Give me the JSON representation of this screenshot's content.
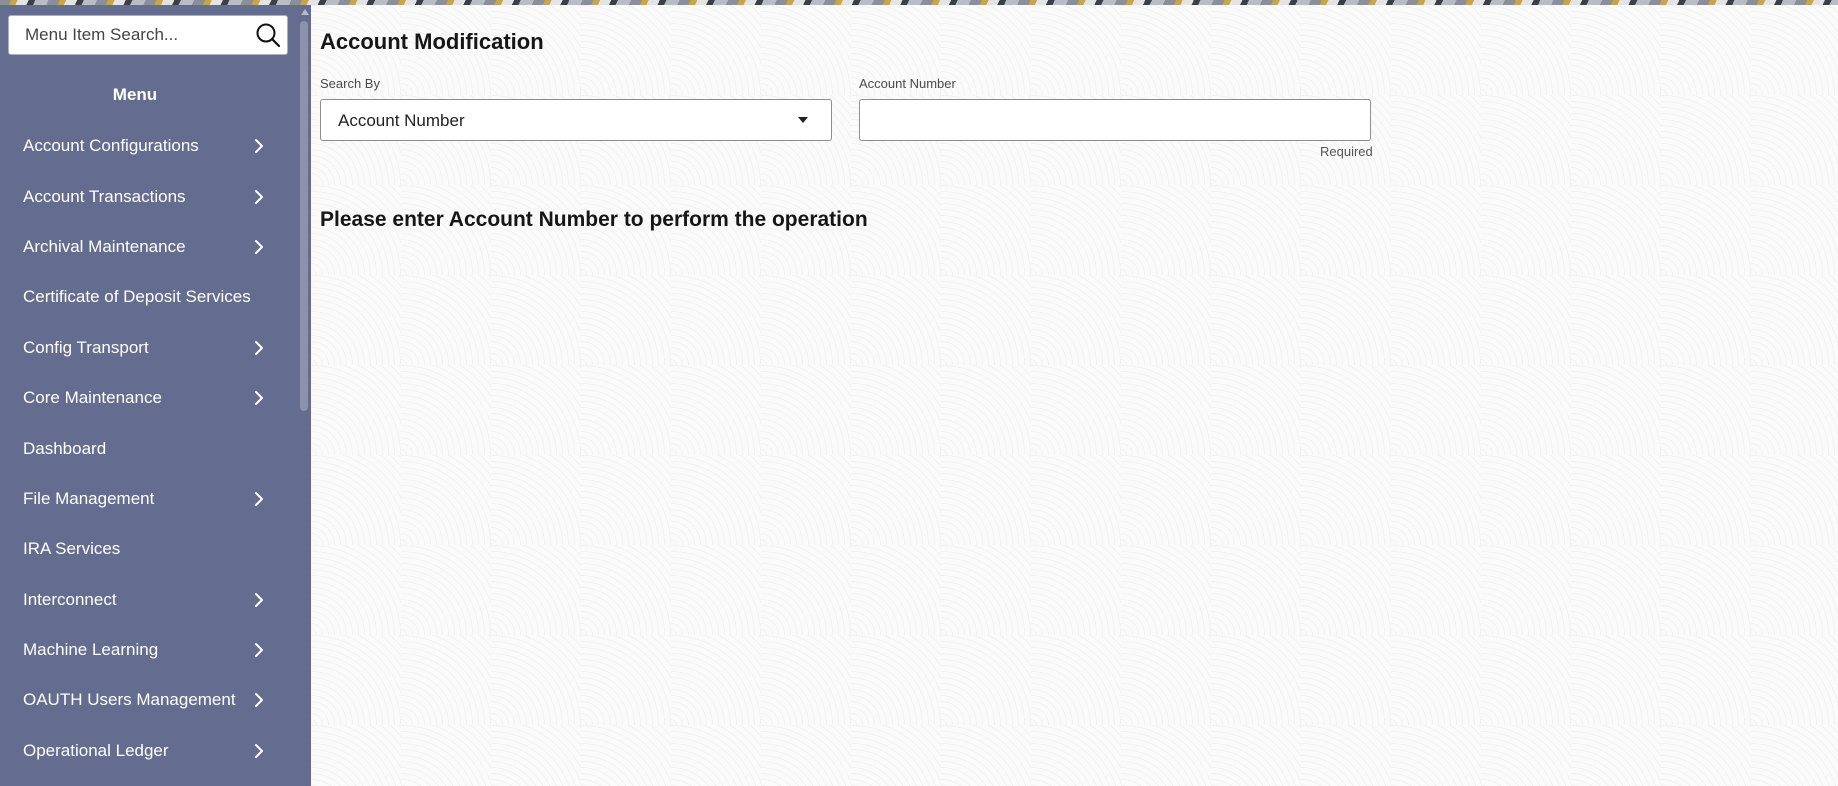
{
  "sidebar": {
    "search": {
      "placeholder": "Menu Item Search..."
    },
    "menu_title": "Menu",
    "items": [
      {
        "label": "Account Configurations",
        "has_submenu": true
      },
      {
        "label": "Account Transactions",
        "has_submenu": true
      },
      {
        "label": "Archival Maintenance",
        "has_submenu": true
      },
      {
        "label": "Certificate of Deposit Services",
        "has_submenu": false
      },
      {
        "label": "Config Transport",
        "has_submenu": true
      },
      {
        "label": "Core Maintenance",
        "has_submenu": true
      },
      {
        "label": "Dashboard",
        "has_submenu": false
      },
      {
        "label": "File Management",
        "has_submenu": true
      },
      {
        "label": "IRA Services",
        "has_submenu": false
      },
      {
        "label": "Interconnect",
        "has_submenu": true
      },
      {
        "label": "Machine Learning",
        "has_submenu": true
      },
      {
        "label": "OAUTH Users Management",
        "has_submenu": true
      },
      {
        "label": "Operational Ledger",
        "has_submenu": true
      }
    ]
  },
  "main": {
    "title": "Account Modification",
    "search_by": {
      "label": "Search By",
      "value": "Account Number"
    },
    "account_number": {
      "label": "Account Number",
      "value": "",
      "hint": "Required"
    },
    "message": "Please enter Account Number to perform the operation"
  },
  "colors": {
    "sidebar_bg": "#646d8f",
    "main_bg": "#fafafa",
    "text_dark": "#161616"
  },
  "icons": {
    "search": "search-icon",
    "submenu": "chevron-right-icon",
    "dropdown": "caret-down-icon"
  }
}
